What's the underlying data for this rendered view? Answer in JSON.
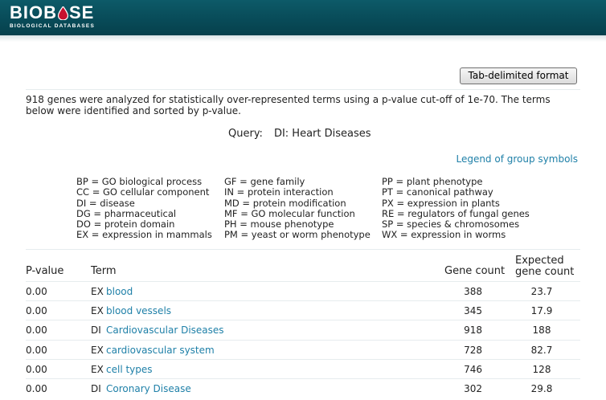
{
  "brand": {
    "name_before": "BIOB",
    "name_after": "SE",
    "subtitle": "BIOLOGICAL DATABASES",
    "accent": "#c8102e"
  },
  "toolbar": {
    "export_label": "Tab-delimited format"
  },
  "intro_text": "918 genes were analyzed for statistically over-represented terms using a p-value cut-off of 1e-70. The terms below were identified and sorted by p-value.",
  "query": {
    "label": "Query:",
    "value": "DI: Heart Diseases"
  },
  "legend": {
    "link_label": "Legend of group symbols",
    "col1": [
      "BP = GO biological process",
      "CC = GO cellular component",
      "DI = disease",
      "DG = pharmaceutical",
      "DO = protein domain",
      "EX = expression in mammals"
    ],
    "col2": [
      "GF = gene family",
      "IN = protein interaction",
      "MD = protein modification",
      "MF = GO molecular function",
      "PH = mouse phenotype",
      "PM = yeast or worm phenotype"
    ],
    "col3": [
      "PP = plant phenotype",
      "PT = canonical pathway",
      "PX = expression in plants",
      "RE = regulators of fungal genes",
      "SP = species & chromosomes",
      "WX = expression in worms"
    ]
  },
  "table": {
    "headers": {
      "pvalue": "P-value",
      "term": "Term",
      "gene_count": "Gene count",
      "expected_line1": "Expected",
      "expected_line2": "gene count"
    },
    "rows": [
      {
        "pvalue": "0.00",
        "group": "EX",
        "term": "blood",
        "gene_count": "388",
        "expected": "23.7"
      },
      {
        "pvalue": "0.00",
        "group": "EX",
        "term": "blood vessels",
        "gene_count": "345",
        "expected": "17.9"
      },
      {
        "pvalue": "0.00",
        "group": "DI",
        "term": "Cardiovascular Diseases",
        "gene_count": "918",
        "expected": "188"
      },
      {
        "pvalue": "0.00",
        "group": "EX",
        "term": "cardiovascular system",
        "gene_count": "728",
        "expected": "82.7"
      },
      {
        "pvalue": "0.00",
        "group": "EX",
        "term": "cell types",
        "gene_count": "746",
        "expected": "128"
      },
      {
        "pvalue": "0.00",
        "group": "DI",
        "term": "Coronary Disease",
        "gene_count": "302",
        "expected": "29.8"
      }
    ]
  }
}
